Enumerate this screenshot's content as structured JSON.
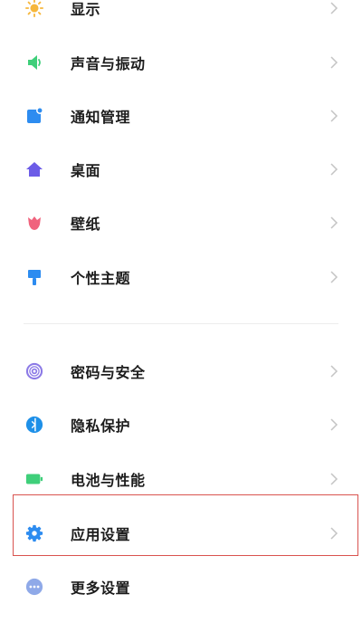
{
  "settings": {
    "items": [
      {
        "label": "显示",
        "icon": "brightness-icon"
      },
      {
        "label": "声音与振动",
        "icon": "speaker-icon"
      },
      {
        "label": "通知管理",
        "icon": "notification-icon"
      },
      {
        "label": "桌面",
        "icon": "home-icon"
      },
      {
        "label": "壁纸",
        "icon": "tulip-icon"
      },
      {
        "label": "个性主题",
        "icon": "brush-icon"
      },
      {
        "label": "密码与安全",
        "icon": "fingerprint-icon"
      },
      {
        "label": "隐私保护",
        "icon": "privacy-icon"
      },
      {
        "label": "电池与性能",
        "icon": "battery-icon"
      },
      {
        "label": "应用设置",
        "icon": "gear-icon"
      },
      {
        "label": "更多设置",
        "icon": "more-icon"
      }
    ]
  },
  "colors": {
    "highlight_border": "#d9534f",
    "label": "#1c1c1c",
    "chevron": "#c4c4c4"
  }
}
